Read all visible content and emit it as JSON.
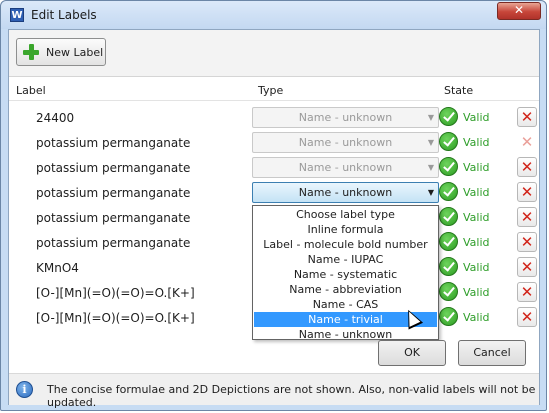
{
  "window": {
    "title": "Edit Labels",
    "app_icon": "W",
    "close": "✕"
  },
  "toolbar": {
    "new_label": "New Label"
  },
  "columns": {
    "label": "Label",
    "type": "Type",
    "state": "State"
  },
  "rows": [
    {
      "label": "24400",
      "type": "Name - unknown",
      "state": "Valid"
    },
    {
      "label": "potassium permanganate",
      "type": "Name - unknown",
      "state": "Valid"
    },
    {
      "label": "potassium permanganate",
      "type": "Name - unknown",
      "state": "Valid"
    },
    {
      "label": "potassium permanganate",
      "type": "Name - unknown",
      "state": "Valid"
    },
    {
      "label": "potassium permanganate",
      "type": "",
      "state": "Valid"
    },
    {
      "label": "potassium permanganate",
      "type": "",
      "state": "Valid"
    },
    {
      "label": "KMnO4",
      "type": "",
      "state": "Valid"
    },
    {
      "label": "[O-][Mn](=O)(=O)=O.[K+]",
      "type": "",
      "state": "Valid"
    },
    {
      "label": "[O-][Mn](=O)(=O)=O.[K+]",
      "type": "",
      "state": "Valid"
    }
  ],
  "dropdown": {
    "options": [
      "Choose label type",
      "Inline formula",
      "Label - molecule bold number",
      "Name - IUPAC",
      "Name - systematic",
      "Name - abbreviation",
      "Name - CAS",
      "Name - trivial",
      "Name - unknown"
    ],
    "highlighted": "Name - trivial"
  },
  "buttons": {
    "ok": "OK",
    "cancel": "Cancel"
  },
  "status": {
    "info": "The concise formulae and 2D Depictions are not shown. Also, non-valid labels will not be updated."
  },
  "colors": {
    "valid": "#2f9e2a",
    "delete": "#d1241a",
    "highlight": "#3399ff"
  }
}
